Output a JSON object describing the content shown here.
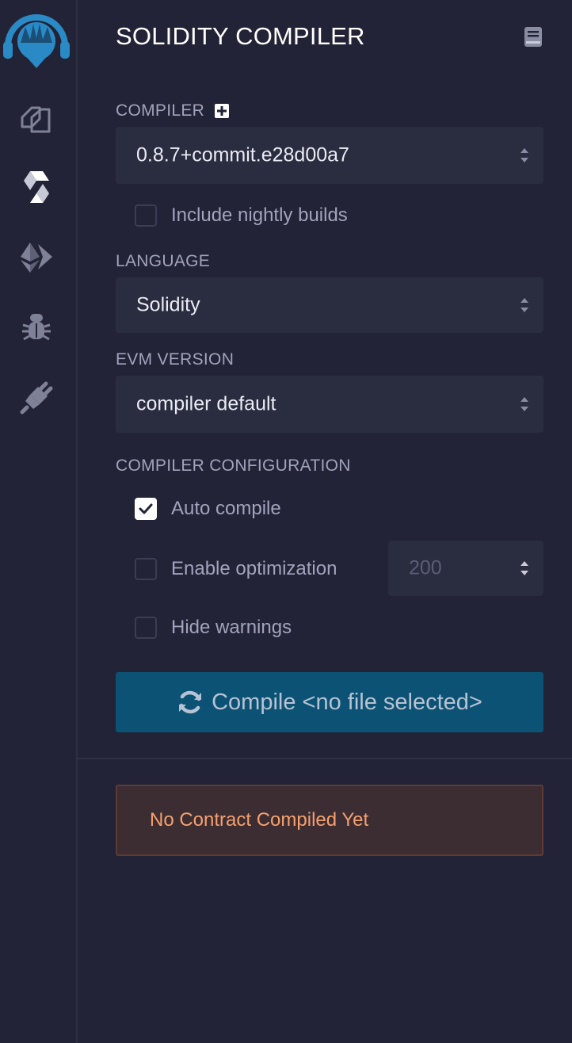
{
  "app": {
    "title": "SOLIDITY COMPILER"
  },
  "sidebar": {
    "items": [
      {
        "name": "remix-logo-icon"
      },
      {
        "name": "file-explorer-icon"
      },
      {
        "name": "solidity-compiler-icon"
      },
      {
        "name": "deploy-run-icon"
      },
      {
        "name": "debugger-icon"
      },
      {
        "name": "plugin-manager-icon"
      }
    ]
  },
  "compiler": {
    "label": "COMPILER",
    "version": "0.8.7+commit.e28d00a7",
    "nightly_label": "Include nightly builds",
    "nightly_checked": false
  },
  "language": {
    "label": "LANGUAGE",
    "value": "Solidity"
  },
  "evm": {
    "label": "EVM VERSION",
    "value": "compiler default"
  },
  "config": {
    "label": "COMPILER CONFIGURATION",
    "auto_compile_label": "Auto compile",
    "auto_compile_checked": true,
    "optimization_label": "Enable optimization",
    "optimization_checked": false,
    "runs_value": "200",
    "hide_warnings_label": "Hide warnings",
    "hide_warnings_checked": false
  },
  "compile_button": {
    "label": "Compile <no file selected>"
  },
  "status": {
    "message": "No Contract Compiled Yet"
  },
  "colors": {
    "background": "#222336",
    "input_bg": "#2a2c3f",
    "button_bg": "#0b5275",
    "brand": "#2a8ac6",
    "warning_text": "#f5a06e",
    "warning_bg": "#3c2d33"
  }
}
